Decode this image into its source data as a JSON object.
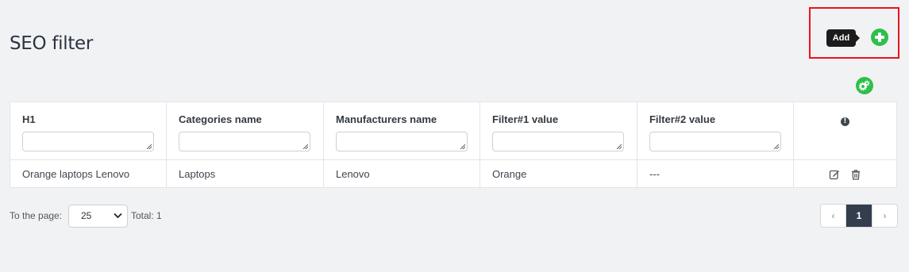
{
  "page": {
    "title": "SEO filter"
  },
  "toolbar": {
    "add_tooltip": "Add",
    "add_icon": "plus-circle-icon",
    "settings_icon": "gears-icon",
    "accent_color": "#2fbf4b",
    "highlight_color": "#e8141a"
  },
  "table": {
    "columns": [
      "H1",
      "Categories name",
      "Manufacturers name",
      "Filter#1 value",
      "Filter#2 value"
    ],
    "actions_header_icon": "info-icon",
    "actions_header_glyph": "!",
    "filters": [
      "",
      "",
      "",
      "",
      ""
    ],
    "rows": [
      {
        "cells": [
          "Orange laptops Lenovo",
          "Laptops",
          "Lenovo",
          "Orange",
          "---"
        ],
        "actions": [
          "edit-icon",
          "trash-icon"
        ]
      }
    ]
  },
  "footer": {
    "to_page_label": "To the page:",
    "per_page_value": "25",
    "total_label": "Total: 1",
    "pagination": {
      "prev_glyph": "‹",
      "current_page": "1",
      "next_glyph": "›"
    }
  }
}
